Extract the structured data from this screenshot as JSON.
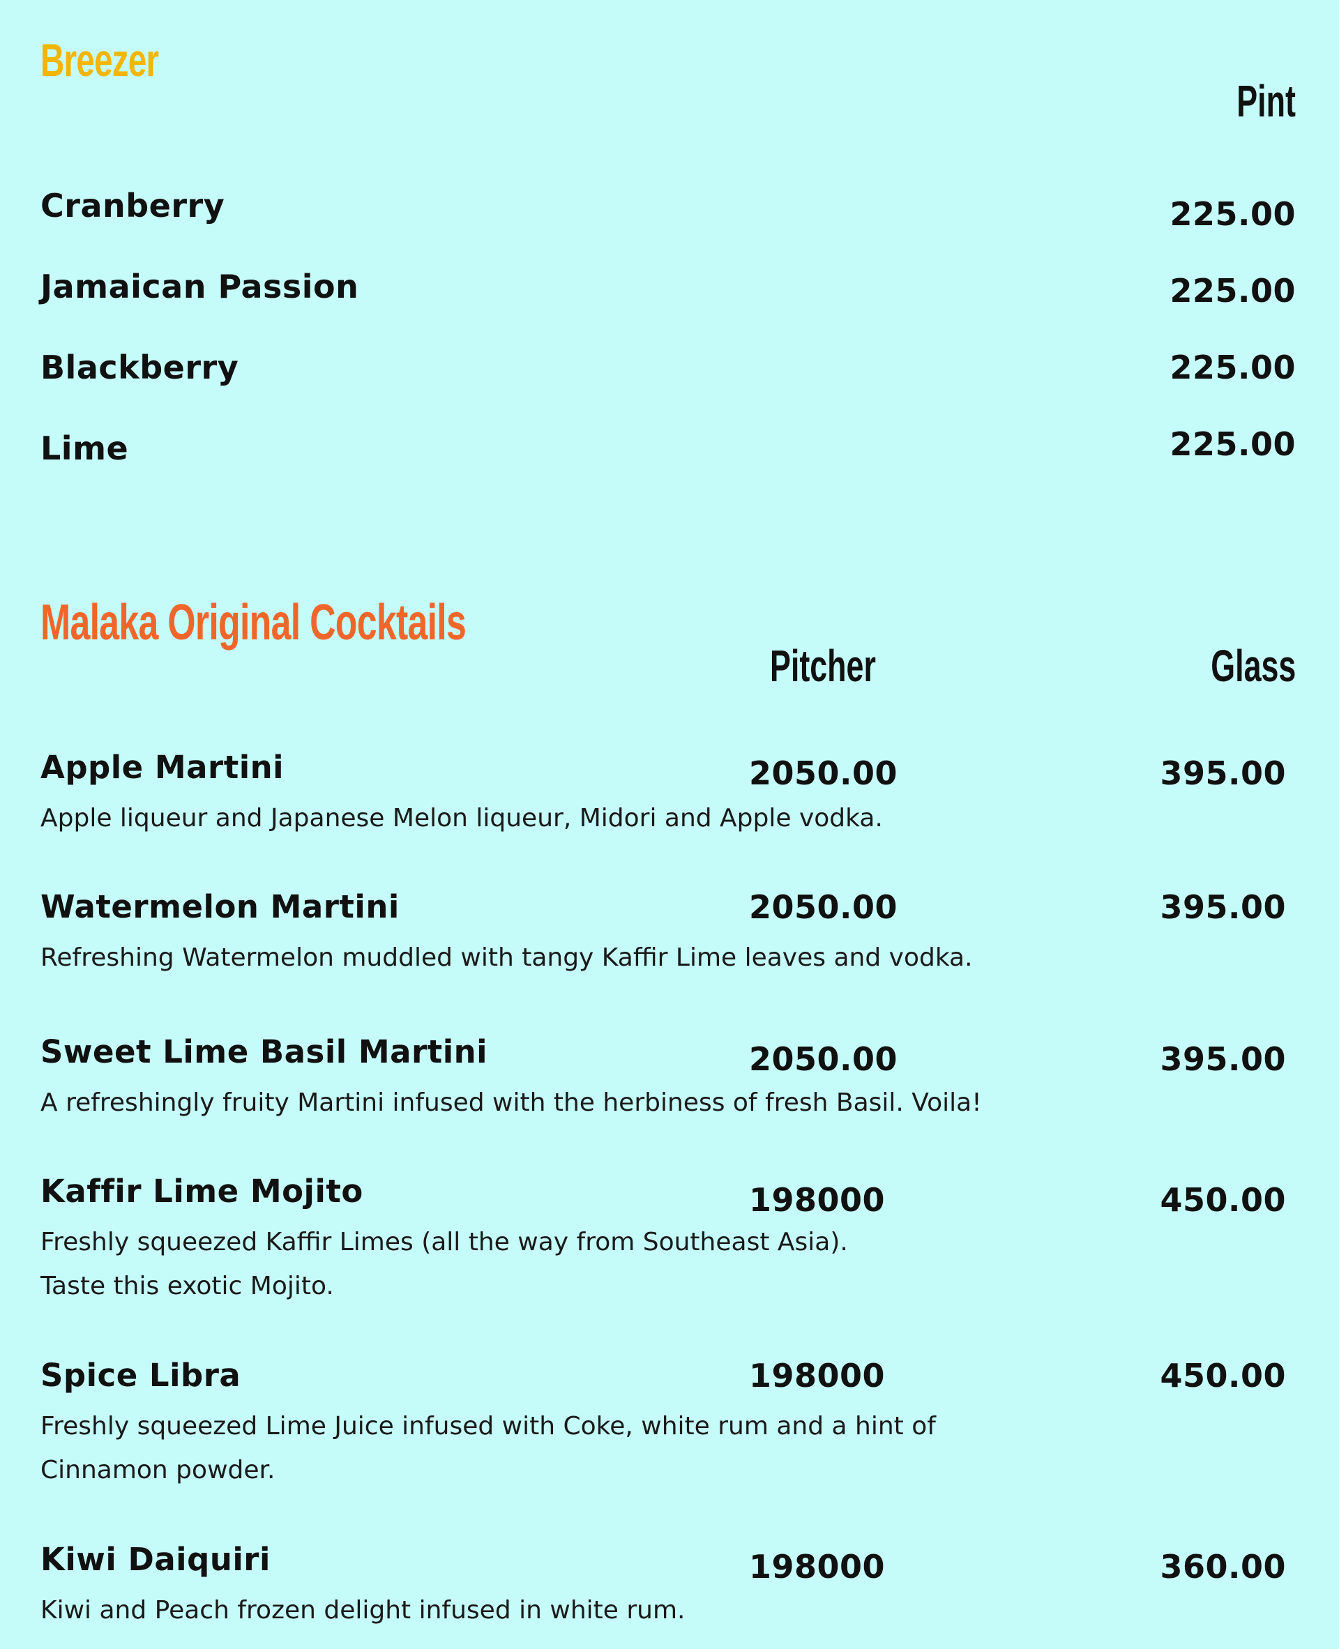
{
  "breezer": {
    "title": "Breezer",
    "column": "Pint",
    "items": [
      {
        "name": "Cranberry",
        "pint": "225.00"
      },
      {
        "name": "Jamaican Passion",
        "pint": "225.00"
      },
      {
        "name": "Blackberry",
        "pint": "225.00"
      },
      {
        "name": "Lime",
        "pint": "225.00"
      }
    ]
  },
  "cocktails": {
    "title": "Malaka Original Cocktails",
    "columns": {
      "pitcher": "Pitcher",
      "glass": "Glass"
    },
    "items": [
      {
        "name": "Apple Martini",
        "pitcher": "2050.00",
        "glass": "395.00",
        "desc": "Apple liqueur and Japanese Melon liqueur, Midori and Apple vodka."
      },
      {
        "name": "Watermelon Martini",
        "pitcher": "2050.00",
        "glass": "395.00",
        "desc": "Refreshing Watermelon muddled with tangy Kaffir Lime leaves and vodka."
      },
      {
        "name": "Sweet Lime Basil Martini",
        "pitcher": "2050.00",
        "glass": "395.00",
        "desc": "A refreshingly fruity Martini infused with the herbiness of fresh Basil. Voila!"
      },
      {
        "name": "Kaffir Lime Mojito",
        "pitcher": "198000",
        "glass": "450.00",
        "desc_lines": [
          "Freshly squeezed Kaffir Limes (all the way from Southeast Asia).",
          "Taste this exotic Mojito."
        ]
      },
      {
        "name": "Spice Libra",
        "pitcher": "198000",
        "glass": "450.00",
        "desc_lines": [
          "Freshly squeezed Lime Juice infused with Coke, white rum and a hint of",
          "Cinnamon powder."
        ]
      },
      {
        "name": "Kiwi Daiquiri",
        "pitcher": "198000",
        "glass": "360.00",
        "desc": "Kiwi and Peach frozen delight infused in white rum."
      }
    ]
  },
  "colors": {
    "background": "#c5fbf8",
    "breezer_title": "#f2b500",
    "cocktails_title": "#f0662a",
    "text": "#111111"
  }
}
